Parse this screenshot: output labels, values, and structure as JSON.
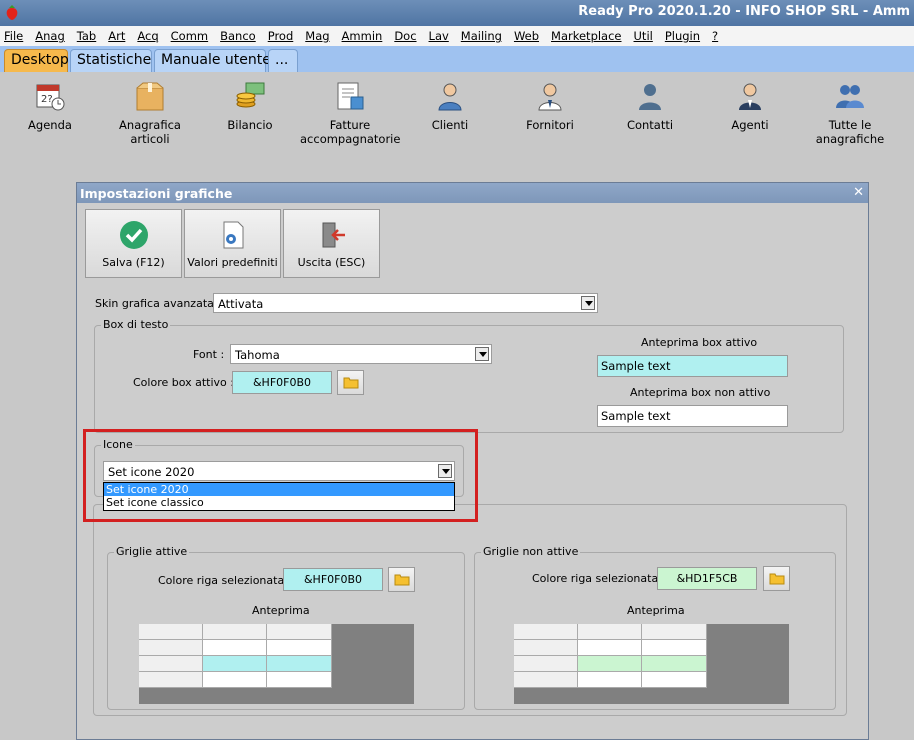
{
  "window": {
    "title": "Ready Pro 2020.1.20 - INFO SHOP SRL - Amm"
  },
  "menu": [
    "File",
    "Anag",
    "Tab",
    "Art",
    "Acq",
    "Comm",
    "Banco",
    "Prod",
    "Mag",
    "Ammin",
    "Doc",
    "Lav",
    "Mailing",
    "Web",
    "Marketplace",
    "Util",
    "Plugin",
    "?"
  ],
  "tabs": [
    "Desktop",
    "Statistiche",
    "Manuale utente",
    "..."
  ],
  "desktop_icons": [
    {
      "label": "Agenda",
      "icon": "calendar-icon"
    },
    {
      "label": "Anagrafica articoli",
      "icon": "box-icon"
    },
    {
      "label": "Bilancio",
      "icon": "money-icon"
    },
    {
      "label": "Fatture accompagnatorie",
      "icon": "invoice-icon"
    },
    {
      "label": "Clienti",
      "icon": "clients-icon"
    },
    {
      "label": "Fornitori",
      "icon": "suppliers-icon"
    },
    {
      "label": "Contatti",
      "icon": "contacts-icon"
    },
    {
      "label": "Agenti",
      "icon": "agents-icon"
    },
    {
      "label": "Tutte le anagrafiche",
      "icon": "all-registries-icon"
    }
  ],
  "dialog": {
    "title": "Impostazioni grafiche",
    "close": "✕",
    "toolbar": {
      "save": "Salva (F12)",
      "defaults": "Valori predefiniti",
      "exit": "Uscita (ESC)"
    },
    "skin_label": "Skin grafica avanzata :",
    "skin_value": "Attivata",
    "textbox_group": {
      "title": "Box di testo",
      "font_label": "Font :",
      "font_value": "Tahoma",
      "active_color_label": "Colore box attivo :",
      "active_color_value": "&HF0F0B0",
      "preview_active_label": "Anteprima box attivo",
      "preview_active_text": "Sample text",
      "preview_inactive_label": "Anteprima box non attivo",
      "preview_inactive_text": "Sample text"
    },
    "icons_group": {
      "title": "Icone",
      "selected": "Set icone 2020",
      "options": [
        "Set icone 2020",
        "Set icone classico"
      ]
    },
    "grids_active": {
      "title": "Griglie attive",
      "row_color_label": "Colore riga selezionata :",
      "row_color_value": "&HF0F0B0",
      "preview_label": "Anteprima"
    },
    "grids_inactive": {
      "title": "Griglie non attive",
      "row_color_label": "Colore riga selezionata :",
      "row_color_value": "&HD1F5CB",
      "preview_label": "Anteprima"
    },
    "colors": {
      "active_box": "#b0f0f0",
      "inactive_row": "#cbf5d1"
    }
  }
}
